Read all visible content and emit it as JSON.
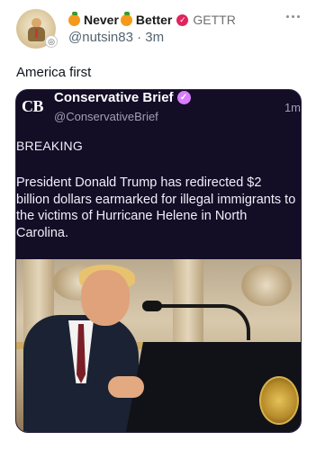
{
  "post": {
    "author": {
      "name_part1": "Never",
      "name_part2": "Better",
      "platform": "GETTR",
      "handle": "@nutsin83",
      "time": "3m"
    },
    "text": "America first"
  },
  "embedded_post": {
    "logo": "CB",
    "name": "Conservative Brief",
    "handle": "@ConservativeBrief",
    "time": "1m",
    "label": "BREAKING",
    "body": "President Donald Trump has redirected $2 billion dollars earmarked for illegal immigrants to the victims of Hurricane Helene in North Carolina."
  },
  "icons": {
    "more": "more-horizontal-icon",
    "verified": "verified-badge-icon",
    "orange": "orange-emoji-icon"
  },
  "colors": {
    "card_bg": "#130d26",
    "verified_red": "#e0245e",
    "verified_purple": "#d97cff",
    "handle_gray": "#536471"
  }
}
